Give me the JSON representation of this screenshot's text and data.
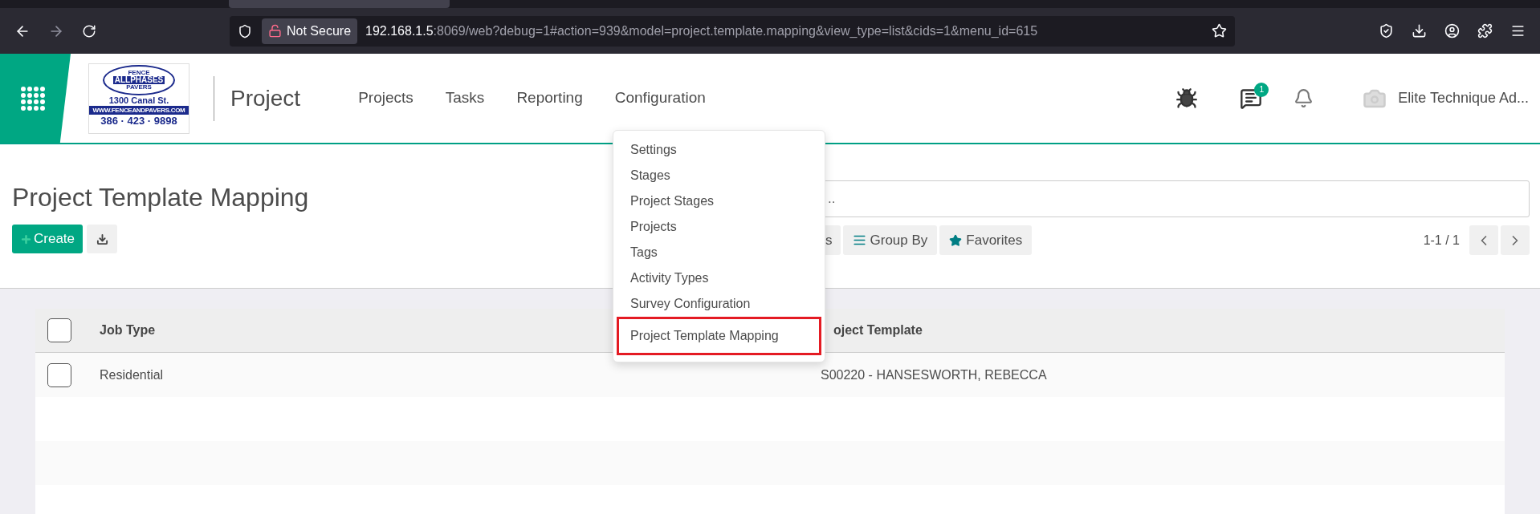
{
  "browser": {
    "security_label": "Not Secure",
    "url_host": "192.168.1.5",
    "url_rest": ":8069/web?debug=1#action=939&model=project.template.mapping&view_type=list&cids=1&menu_id=615"
  },
  "app": {
    "logo": {
      "top": "FENCE",
      "name": "ALLPHASES",
      "bottom": "PAVERS",
      "address": "1300 Canal St.",
      "website": "WWW.FENCEANDPAVERS.COM",
      "phone": "386 · 423 · 9898"
    },
    "title": "Project",
    "menu": [
      "Projects",
      "Tasks",
      "Reporting",
      "Configuration"
    ],
    "messages_badge": "1",
    "user": "Elite Technique Ad..."
  },
  "dropdown": [
    {
      "label": "Settings",
      "selected": false
    },
    {
      "label": "Stages",
      "selected": false
    },
    {
      "label": "Project Stages",
      "selected": false
    },
    {
      "label": "Projects",
      "selected": false
    },
    {
      "label": "Tags",
      "selected": false
    },
    {
      "label": "Activity Types",
      "selected": false
    },
    {
      "label": "Survey Configuration",
      "selected": false
    },
    {
      "label": "Project Template Mapping",
      "selected": true
    }
  ],
  "page": {
    "title": "Project Template Mapping",
    "create": "Create",
    "search_placeholder": "..",
    "filter_buttons": [
      {
        "label": "s",
        "kind": "filters"
      },
      {
        "label": "Group By",
        "kind": "group"
      },
      {
        "label": "Favorites",
        "kind": "favorites"
      }
    ],
    "pager": "1-1 / 1"
  },
  "table": {
    "all_checked": false,
    "columns": [
      "Job Type",
      "oject Template"
    ],
    "rows": [
      {
        "cells": [
          "Residential",
          "S00220 - HANSESWORTH, REBECCA"
        ],
        "checked": false
      }
    ]
  }
}
